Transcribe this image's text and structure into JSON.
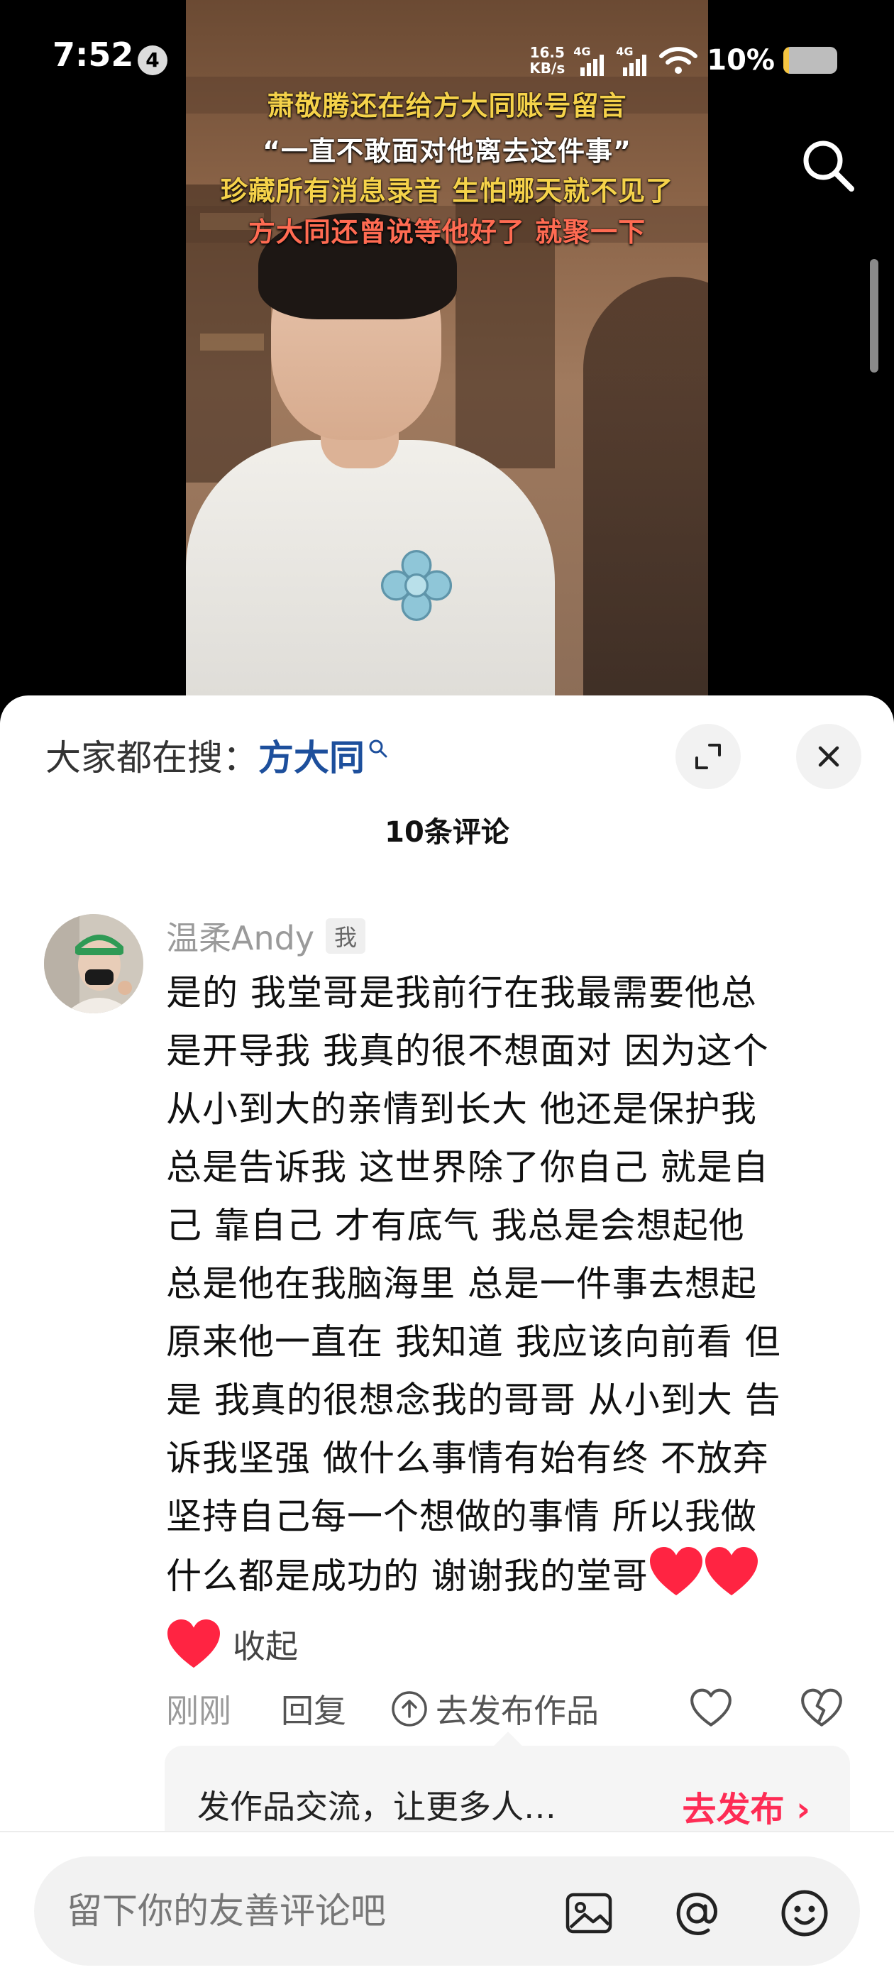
{
  "status_bar": {
    "time": "7:52",
    "notification_count": "4",
    "net_speed_value": "16.5",
    "net_speed_unit": "KB/s",
    "network_1": "4G",
    "network_2": "4G",
    "battery_percent_label": "10%",
    "battery_level": 0.1
  },
  "video": {
    "captions": [
      "萧敬腾还在给方大同账号留言",
      "“一直不敢面对他离去这件事”",
      "珍藏所有消息录音 生怕哪天就不见了",
      "方大同还曾说等他好了 就聚一下"
    ],
    "caption_colors": [
      "#f5d24a",
      "#ffffff",
      "#f5d24a",
      "#ff6b52"
    ]
  },
  "sheet": {
    "trending_prefix": "大家都在搜：",
    "trending_term": "方大同",
    "comment_count": "10条评论"
  },
  "comment": {
    "username": "温柔Andy",
    "badge": "我",
    "lines": [
      "是的 我堂哥是我前行在我最需要他总",
      "是开导我 我真的很不想面对 因为这个",
      "从小到大的亲情到长大 他还是保护我",
      "总是告诉我 这世界除了你自己 就是自",
      "己 靠自己 才有底气  我总是会想起他",
      "总是他在我脑海里 总是一件事去想起",
      "原来他一直在 我知道 我应该向前看 但",
      "是 我真的很想念我的哥哥 从小到大 告",
      "诉我坚强 做什么事情有始有终 不放弃",
      "坚持自己每一个想做的事情 所以我做",
      "什么都是成功的 谢谢我的堂哥"
    ],
    "collapse_label": "收起",
    "time": "刚刚",
    "reply_label": "回复",
    "publish_label": "去发布作品"
  },
  "promo": {
    "text": "发作品交流，让更多人…",
    "cta": "去发布 ›"
  },
  "input": {
    "placeholder": "留下你的友善评论吧"
  },
  "icons": {
    "search": "search-icon",
    "expand": "expand-icon",
    "close": "close-icon",
    "heart": "heart-icon",
    "like": "like-icon",
    "dislike": "dislike-icon",
    "image": "image-icon",
    "mention": "at-icon",
    "emoji": "emoji-icon"
  },
  "colors": {
    "accent": "#fe2c55",
    "trending": "#1d4f9c",
    "heart": "#ff2442"
  }
}
